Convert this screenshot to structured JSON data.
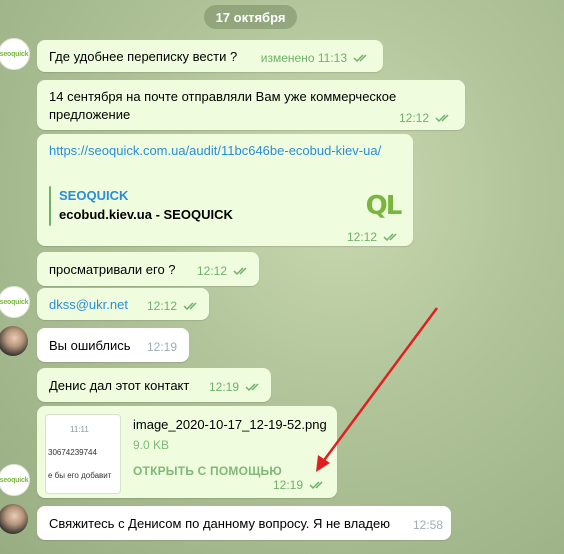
{
  "date_separator": "17 октября",
  "avatars": {
    "seo_logo_text": "seoquick"
  },
  "messages": [
    {
      "text": "Где удобнее переписку вести ?",
      "time": "изменено 11:13"
    },
    {
      "text_line1": "14 сентября на почте отправляли Вам уже коммерческое",
      "text_line2": "предложение",
      "time": "12:12"
    },
    {
      "link": "https://seoquick.com.ua/audit/11bc646be-ecobud-kiev-ua/",
      "preview_site": "SEOQUICK",
      "preview_title": "ecobud.kiev.ua - SEOQUICK",
      "preview_logo": "QL",
      "time": "12:12"
    },
    {
      "text": "просматривали его ?",
      "time": "12:12"
    },
    {
      "text": "dkss@ukr.net",
      "time": "12:12"
    },
    {
      "text": "Вы ошиблись",
      "time": "12:19"
    },
    {
      "text": "Денис дал этот контакт",
      "time": "12:19"
    },
    {
      "file_name": "image_2020-10-17_12-19-52.png",
      "file_size": "9.0 KB",
      "open_label": "ОТКРЫТЬ С ПОМОЩЬЮ",
      "time": "12:19",
      "thumb_line1": "11:11",
      "thumb_line2": "30674239744",
      "thumb_line3": "е бы его добавит"
    },
    {
      "text": "Свяжитесь с Денисом по данному вопросу. Я не владею",
      "time": "12:58"
    }
  ],
  "colors": {
    "outgoing_bubble": "#effdde",
    "incoming_bubble": "#ffffff",
    "accent_green": "#6fb16b",
    "link_blue": "#2a8dd6",
    "annotation_arrow": "#e02020"
  }
}
